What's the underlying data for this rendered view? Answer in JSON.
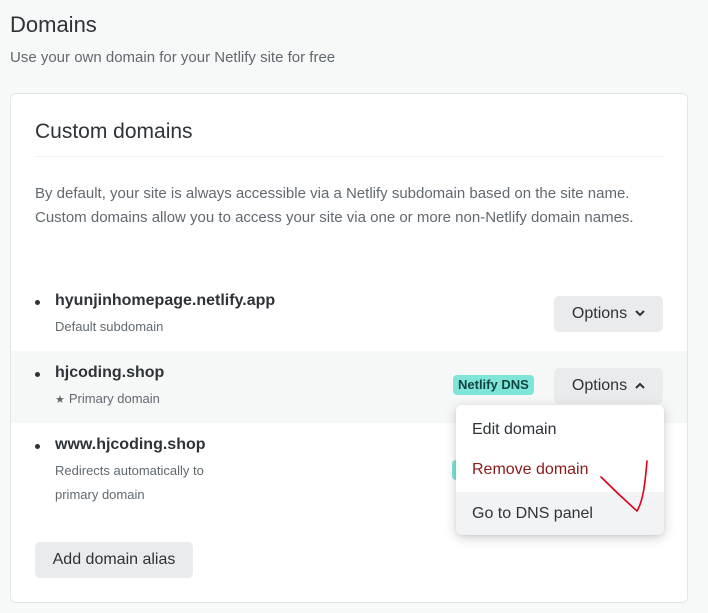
{
  "header": {
    "title": "Domains",
    "subtitle": "Use your own domain for your Netlify site for free"
  },
  "card": {
    "title": "Custom domains",
    "description": "By default, your site is always accessible via a Netlify subdomain based on the site name. Custom domains allow you to access your site via one or more non-Netlify domain names."
  },
  "domains": [
    {
      "name": "hyunjinhomepage.netlify.app",
      "subtitle": "Default subdomain",
      "options_label": "Options"
    },
    {
      "name": "hjcoding.shop",
      "subtitle": "Primary domain",
      "badge": "Netlify DNS",
      "options_label": "Options",
      "star_icon": "star-icon"
    },
    {
      "name": "www.hjcoding.shop",
      "subtitle_line1": "Redirects automatically to",
      "subtitle_line2": "primary domain"
    }
  ],
  "add_alias_label": "Add domain alias",
  "menu": {
    "items": [
      {
        "label": "Edit domain"
      },
      {
        "label": "Remove domain"
      },
      {
        "label": "Go to DNS panel"
      }
    ]
  },
  "colors": {
    "badge": "#7ee5d8",
    "danger": "#8b1a1a",
    "annotation": "#e0001a"
  }
}
